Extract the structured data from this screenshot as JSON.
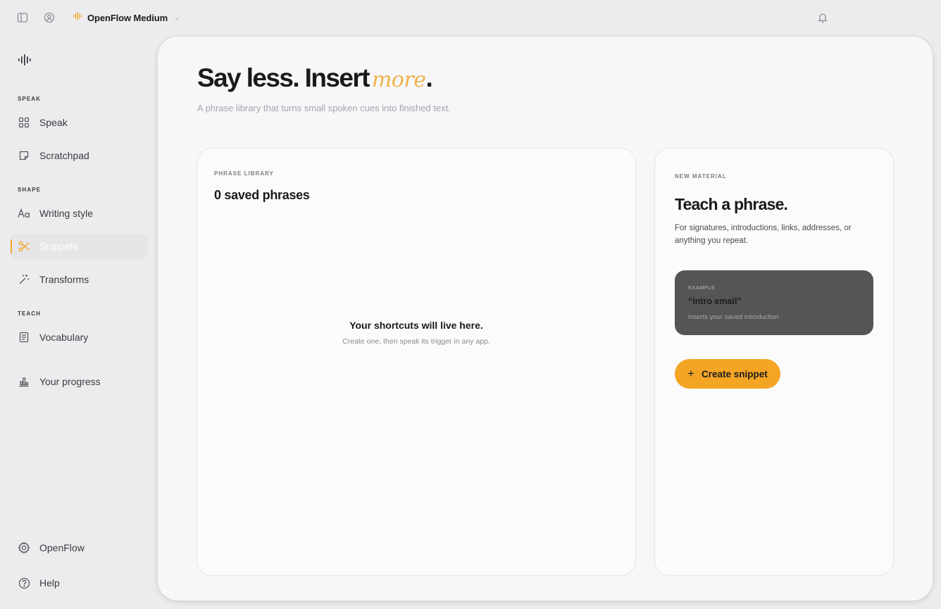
{
  "topbar": {
    "workspace_name": "OpenFlow Medium",
    "icons": [
      "sidebar-toggle-icon",
      "account-icon",
      "waveform-icon",
      "chevron-down-icon",
      "bell-icon"
    ]
  },
  "sidebar": {
    "sections": {
      "speak": "SPEAK",
      "shape": "SHAPE",
      "teach": "TEACH"
    },
    "items": [
      {
        "label": "Speak",
        "icon": "grid-icon"
      },
      {
        "label": "Scratchpad",
        "icon": "note-icon"
      },
      {
        "label": "Writing style",
        "icon": "text-style-icon"
      },
      {
        "label": "Snippets",
        "icon": "scissors-icon",
        "active": true
      },
      {
        "label": "Transforms",
        "icon": "magic-wand-icon"
      },
      {
        "label": "Vocabulary",
        "icon": "book-icon"
      },
      {
        "label": "Your progress",
        "icon": "chart-icon"
      },
      {
        "label": "OpenFlow",
        "icon": "gear-icon"
      },
      {
        "label": "Help",
        "icon": "help-icon"
      }
    ]
  },
  "main": {
    "title": "Say less. Insert",
    "title_accent": "more",
    "title_end": ".",
    "subtitle": "A phrase library that turns small spoken cues into finished text."
  },
  "library": {
    "eyebrow": "PHRASE LIBRARY",
    "count": "0 saved phrases",
    "empty_title": "Your shortcuts will live here.",
    "empty_subtitle": "Create one, then speak its trigger in any app."
  },
  "new_material": {
    "eyebrow": "NEW MATERIAL",
    "title": "Teach a phrase.",
    "description": "For signatures, introductions, links, addresses, or anything you repeat.",
    "example_label": "EXAMPLE",
    "example_phrase": "“intro email”",
    "example_note": "inserts your saved introduction",
    "create_button": "Create snippet"
  },
  "colors": {
    "accent": "#f5a524",
    "sidebar_bg": "#ececee",
    "panel_bg": "#f7f7f9",
    "example_bg": "#555557"
  }
}
